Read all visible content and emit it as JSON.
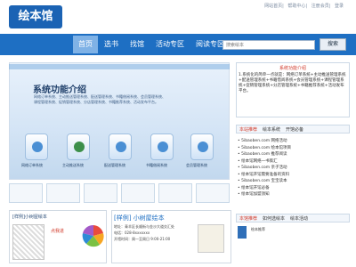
{
  "topbar": {
    "links": [
      "网站首页",
      "帮助中心",
      "注册会员",
      "登录"
    ]
  },
  "logo": {
    "text": "绘本馆"
  },
  "search": {
    "placeholder": "搜索绘本",
    "button": "搜索"
  },
  "nav": {
    "items": [
      "首页",
      "选书",
      "找馆",
      "活动专区",
      "阅读专区",
      "开馆"
    ]
  },
  "banner": {
    "title": "系统功能介绍",
    "desc1": "网络订单系统、主动推送管理系统、配送管理系统、书籍借阅系统、会员管理系统、",
    "desc2": "课程管理系统、促销管理系统、分店管理系统、书籍推荐系统、活动发布平台。",
    "modules": [
      "网络订单系统",
      "主动推送系统",
      "配送管理系统",
      "书籍借阅系统",
      "会员管理系统"
    ]
  },
  "right": {
    "title": "系统功能介绍",
    "text": "1.系统化的简单一点就是：网络订单系统+主动推送管理系统+配送管理系统+书籍借阅系统+会员管理系统+课程管理系统+促销管理系统+分店管理系统+书籍推荐系统+活动发布平台。",
    "tabs": [
      "本站推荐",
      "绘本系统",
      "开馆必备"
    ],
    "list": [
      "• 5ibaoben.com 网络活动",
      "• 5ibaoben.com 绘本馆项目",
      "• 5ibaoben.com 推荐阅读",
      "• 绘本馆网络一书策汇",
      "• 5ibaoben.com 亲子活动",
      "• 绘本馆开馆需要准备的资料",
      "• 5ibaoben.com 宝宝读本",
      "• 绘本馆开馆必备",
      "• 绘本馆加盟须知"
    ],
    "tabs2": [
      "本馆推荐",
      "如何选绘本",
      "绘本活动"
    ],
    "booktext": "绘本推荐"
  },
  "cards": {
    "card1_title": "[样例]小树屋绘本",
    "card1_sub": "点我进",
    "card2_title": "[样例] 小树屋绘本",
    "card2_line1": "地址：青羊区长顺街与金沙大道交汇处",
    "card2_line2": "电话：028-8xxxxxxx",
    "card2_line3": "开馆时间：周一至周日 9:00-21:00"
  }
}
